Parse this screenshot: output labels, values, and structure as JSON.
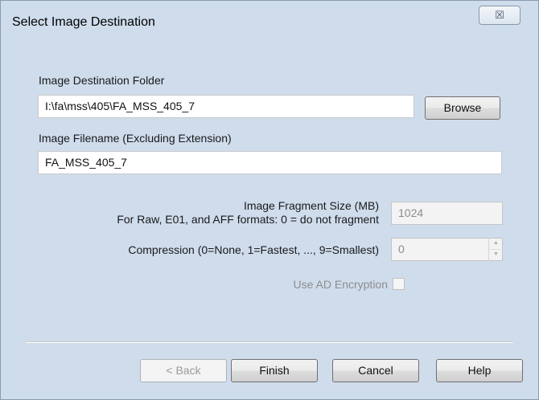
{
  "dialog": {
    "title": "Select Image Destination",
    "close_glyph": "☒"
  },
  "destination": {
    "folder_label": "Image Destination Folder",
    "folder_value": "I:\\fa\\mss\\405\\FA_MSS_405_7",
    "browse_label": "Browse",
    "filename_label": "Image Filename (Excluding Extension)",
    "filename_value": "FA_MSS_405_7"
  },
  "options": {
    "fragment_label_line1": "Image Fragment Size (MB)",
    "fragment_label_line2": "For Raw, E01, and AFF formats: 0 = do not fragment",
    "fragment_value": "1024",
    "compression_label": "Compression (0=None, 1=Fastest, ..., 9=Smallest)",
    "compression_value": "0",
    "encryption_label": "Use AD Encryption",
    "encryption_checked": false
  },
  "buttons": {
    "back": "< Back",
    "finish": "Finish",
    "cancel": "Cancel",
    "help": "Help"
  },
  "icons": {
    "spin_up": "spin-up-arrow-icon",
    "spin_down": "spin-down-arrow-icon"
  }
}
